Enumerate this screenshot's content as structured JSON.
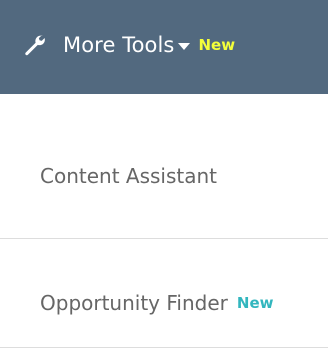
{
  "header": {
    "icon": "wrench-icon",
    "label": "More Tools",
    "badge": "New",
    "background_color": "#52697f",
    "badge_color": "#f4ff3a"
  },
  "menu": {
    "items": [
      {
        "label": "Content Assistant",
        "badge": ""
      },
      {
        "label": "Opportunity Finder",
        "badge": "New"
      }
    ],
    "text_color": "#666666",
    "badge_color": "#32b6be"
  }
}
